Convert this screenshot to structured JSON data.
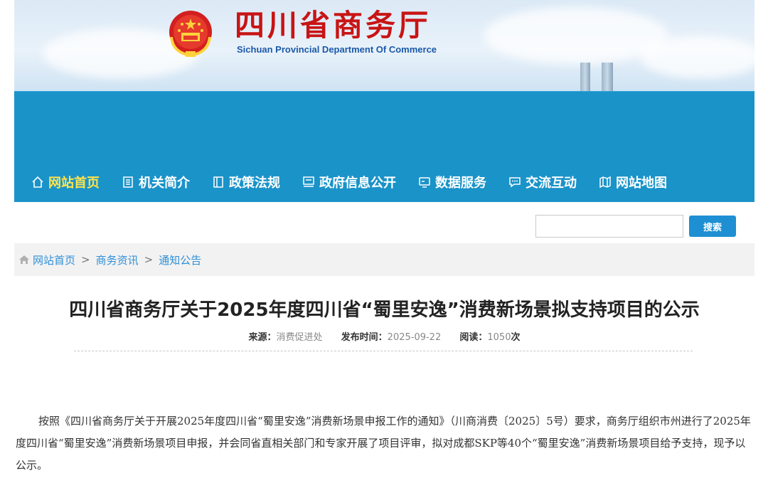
{
  "header": {
    "title_cn": "四川省商务厅",
    "title_en": "Sichuan Provincial Department Of Commerce"
  },
  "nav": {
    "items": [
      {
        "label": "网站首页",
        "icon": "home-icon",
        "active": true
      },
      {
        "label": "机关简介",
        "icon": "document-icon"
      },
      {
        "label": "政策法规",
        "icon": "book-icon"
      },
      {
        "label": "政府信息公开",
        "icon": "info-board-icon"
      },
      {
        "label": "数据服务",
        "icon": "monitor-icon"
      },
      {
        "label": "交流互动",
        "icon": "chat-icon"
      },
      {
        "label": "网站地图",
        "icon": "map-icon"
      }
    ]
  },
  "search": {
    "placeholder": "",
    "button_label": "搜索"
  },
  "breadcrumb": {
    "items": [
      "网站首页",
      "商务资讯",
      "通知公告"
    ],
    "separator": ">"
  },
  "article": {
    "title": "四川省商务厅关于2025年度四川省“蜀里安逸”消费新场景拟支持项目的公示",
    "source_label": "来源：",
    "source_value": "消费促进处",
    "date_label": "发布时间：",
    "date_value": "2025-09-22",
    "views_label": "阅读：",
    "views_value": "1050",
    "views_suffix": "次",
    "body": "按照《四川省商务厅关于开展2025年度四川省“蜀里安逸”消费新场景申报工作的通知》（川商消费〔2025〕5号）要求，商务厅组织市州进行了2025年度四川省“蜀里安逸”消费新场景项目申报，并会同省直相关部门和专家开展了项目评审，拟对成都SKP等40个“蜀里安逸”消费新场景项目给予支持，现予以公示。"
  },
  "colors": {
    "nav_bg": "#1a93c9",
    "nav_active": "#ffe44a",
    "title_red": "#c81414",
    "link_blue": "#2f8fd6",
    "button_blue": "#1e8fd2"
  }
}
